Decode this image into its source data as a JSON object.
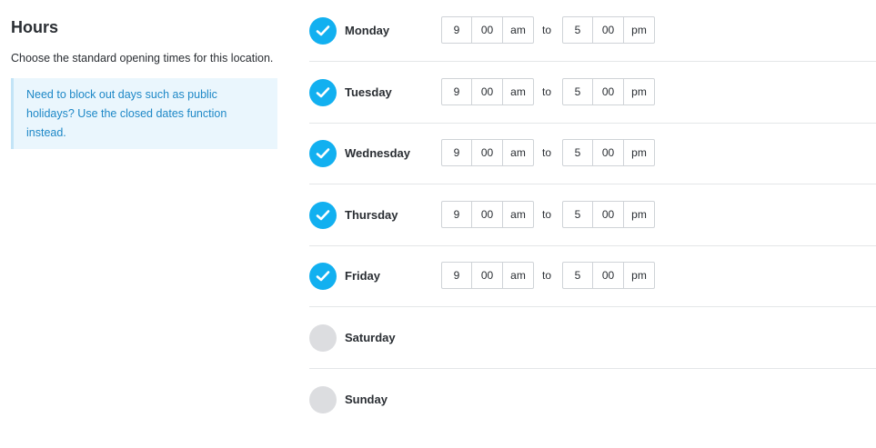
{
  "header": {
    "title": "Hours",
    "subtitle": "Choose the standard opening times for this location."
  },
  "notice": {
    "text": "Need to block out days such as public holidays? Use the closed dates function instead."
  },
  "to_label": "to",
  "colors": {
    "accent": "#12b0f0",
    "notice_text": "#1e88c7",
    "notice_bg": "#eaf6fd",
    "unchecked": "#dcdde0"
  },
  "days": [
    {
      "name": "Monday",
      "enabled": true,
      "open": {
        "hour": "9",
        "minute": "00",
        "period": "am"
      },
      "close": {
        "hour": "5",
        "minute": "00",
        "period": "pm"
      }
    },
    {
      "name": "Tuesday",
      "enabled": true,
      "open": {
        "hour": "9",
        "minute": "00",
        "period": "am"
      },
      "close": {
        "hour": "5",
        "minute": "00",
        "period": "pm"
      }
    },
    {
      "name": "Wednesday",
      "enabled": true,
      "open": {
        "hour": "9",
        "minute": "00",
        "period": "am"
      },
      "close": {
        "hour": "5",
        "minute": "00",
        "period": "pm"
      }
    },
    {
      "name": "Thursday",
      "enabled": true,
      "open": {
        "hour": "9",
        "minute": "00",
        "period": "am"
      },
      "close": {
        "hour": "5",
        "minute": "00",
        "period": "pm"
      }
    },
    {
      "name": "Friday",
      "enabled": true,
      "open": {
        "hour": "9",
        "minute": "00",
        "period": "am"
      },
      "close": {
        "hour": "5",
        "minute": "00",
        "period": "pm"
      }
    },
    {
      "name": "Saturday",
      "enabled": false
    },
    {
      "name": "Sunday",
      "enabled": false
    }
  ]
}
